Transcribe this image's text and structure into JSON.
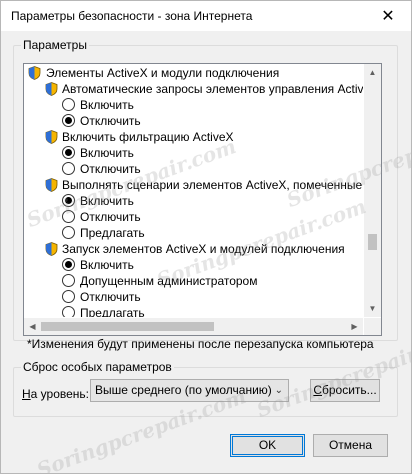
{
  "window": {
    "title": "Параметры безопасности - зона Интернета",
    "close_glyph": "✕"
  },
  "settings_group": {
    "label": "Параметры",
    "items": [
      {
        "kind": "category",
        "text": "Элементы ActiveX и модули подключения"
      },
      {
        "kind": "setting",
        "text": "Автоматические запросы элементов управления ActiveX"
      },
      {
        "kind": "option",
        "text": "Включить",
        "checked": false
      },
      {
        "kind": "option",
        "text": "Отключить",
        "checked": true
      },
      {
        "kind": "setting",
        "text": "Включить фильтрацию ActiveX"
      },
      {
        "kind": "option",
        "text": "Включить",
        "checked": true
      },
      {
        "kind": "option",
        "text": "Отключить",
        "checked": false
      },
      {
        "kind": "setting",
        "text": "Выполнять сценарии элементов ActiveX, помеченные как"
      },
      {
        "kind": "option",
        "text": "Включить",
        "checked": true
      },
      {
        "kind": "option",
        "text": "Отключить",
        "checked": false
      },
      {
        "kind": "option",
        "text": "Предлагать",
        "checked": false
      },
      {
        "kind": "setting",
        "text": "Запуск элементов ActiveX и модулей подключения"
      },
      {
        "kind": "option",
        "text": "Включить",
        "checked": true
      },
      {
        "kind": "option",
        "text": "Допущенным администратором",
        "checked": false
      },
      {
        "kind": "option",
        "text": "Отключить",
        "checked": false
      },
      {
        "kind": "option",
        "text": "Предлагать",
        "checked": false
      }
    ],
    "note": "*Изменения будут применены после перезапуска компьютера"
  },
  "reset_group": {
    "label": "Сброс особых параметров",
    "level_label": "На уровень:",
    "level_value": "Выше среднего (по умолчанию)",
    "reset_button": "Сбросить..."
  },
  "buttons": {
    "ok": "OK",
    "cancel": "Отмена"
  },
  "watermark": "Soringpcrepair.com",
  "colors": {
    "accent": "#0078d7",
    "dialog_bg": "#f0f0f0",
    "list_border": "#828790"
  },
  "icons": {
    "shield": "shield-icon",
    "radio": "radio-button"
  }
}
